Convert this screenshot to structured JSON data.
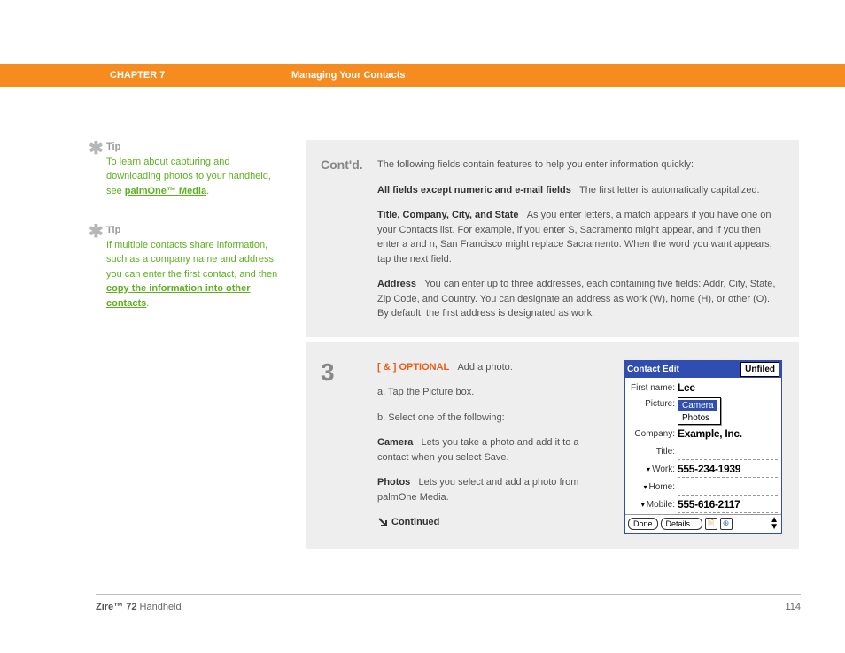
{
  "header": {
    "chapter": "CHAPTER 7",
    "title": "Managing Your Contacts"
  },
  "tips": [
    {
      "label": "Tip",
      "text": "To learn about capturing and downloading photos to your handheld, see ",
      "link": "palmOne™ Media",
      "after": "."
    },
    {
      "label": "Tip",
      "text": "If multiple contacts share information, such as a company name and address, you can enter the first contact, and then ",
      "link": "copy the information into other contacts",
      "after": "."
    }
  ],
  "step_contd": {
    "label": "Cont'd.",
    "intro": "The following fields contain features to help you enter information quickly:",
    "p1_lead": "All fields except numeric and e-mail fields",
    "p1_rest": "The first letter is automatically capitalized.",
    "p2_lead": "Title, Company, City, and State",
    "p2_rest": "As you enter letters, a match appears if you have one on your Contacts list. For example, if you enter S, Sacramento might appear, and if you then enter a and n, San Francisco might replace Sacramento. When the word you want appears, tap the next field.",
    "p3_lead": "Address",
    "p3_rest": "You can enter up to three addresses, each containing five fields: Addr, City, State, Zip Code, and Country. You can designate an address as work (W), home (H), or other (O). By default, the first address is designated as work."
  },
  "step3": {
    "num": "3",
    "bracket": "[ & ]  OPTIONAL",
    "title_rest": "Add a photo:",
    "a": "a.   Tap the Picture box.",
    "b": "b.   Select one of the following:",
    "camera_lead": "Camera",
    "camera_rest": "Lets you take a photo and add it to a contact when you select Save.",
    "photos_lead": "Photos",
    "photos_rest": "Lets you select and add a photo from palmOne Media.",
    "continued": "Continued"
  },
  "widget": {
    "title": "Contact Edit",
    "category": "Unfiled",
    "firstname_label": "First name:",
    "firstname": "Lee",
    "picture_label": "Picture:",
    "opt_camera": "Camera",
    "opt_photos": "Photos",
    "company_label": "Company:",
    "company": "Example, Inc.",
    "title_label": "Title:",
    "work_label": "Work:",
    "work": "555-234-1939",
    "home_label": "Home:",
    "mobile_label": "Mobile:",
    "mobile": "555-616-2117",
    "done": "Done",
    "details": "Details..."
  },
  "footer": {
    "product_bold": "Zire™ 72",
    "product_rest": " Handheld",
    "page": "114"
  }
}
